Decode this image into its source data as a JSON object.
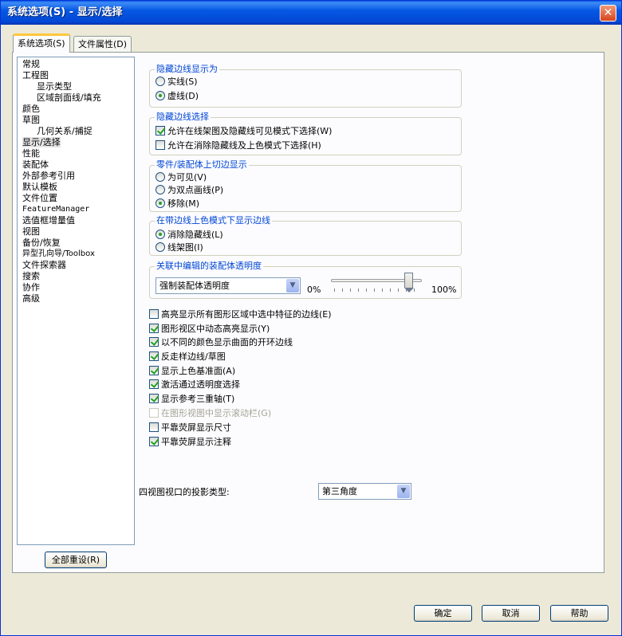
{
  "window": {
    "title": "系统选项(S) - 显示/选择"
  },
  "tabs": [
    "系统选项(S)",
    "文件属性(D)"
  ],
  "tree": {
    "items": [
      {
        "label": "常规",
        "level": 1,
        "selected": false
      },
      {
        "label": "工程图",
        "level": 1,
        "selected": false
      },
      {
        "label": "显示类型",
        "level": 2,
        "selected": false
      },
      {
        "label": "区域剖面线/填充",
        "level": 2,
        "selected": false
      },
      {
        "label": "颜色",
        "level": 1,
        "selected": false
      },
      {
        "label": "草图",
        "level": 1,
        "selected": false
      },
      {
        "label": "几何关系/捕捉",
        "level": 2,
        "selected": false
      },
      {
        "label": "显示/选择",
        "level": 1,
        "selected": true
      },
      {
        "label": "性能",
        "level": 1,
        "selected": false
      },
      {
        "label": "装配体",
        "level": 1,
        "selected": false
      },
      {
        "label": "外部参考引用",
        "level": 1,
        "selected": false
      },
      {
        "label": "默认模板",
        "level": 1,
        "selected": false
      },
      {
        "label": "文件位置",
        "level": 1,
        "selected": false
      },
      {
        "label": "FeatureManager",
        "level": 1,
        "selected": false
      },
      {
        "label": "选值框增量值",
        "level": 1,
        "selected": false
      },
      {
        "label": "视图",
        "level": 1,
        "selected": false
      },
      {
        "label": "备份/恢复",
        "level": 1,
        "selected": false
      },
      {
        "label": "异型孔向导/Toolbox",
        "level": 1,
        "selected": false
      },
      {
        "label": "文件探索器",
        "level": 1,
        "selected": false
      },
      {
        "label": "搜索",
        "level": 1,
        "selected": false
      },
      {
        "label": "协作",
        "level": 1,
        "selected": false
      },
      {
        "label": "高级",
        "level": 1,
        "selected": false
      }
    ],
    "reset_button": "全部重设(R)"
  },
  "groups": {
    "hidden_edges_display": {
      "title": "隐藏边线显示为",
      "options": [
        {
          "label": "实线(S)",
          "checked": false
        },
        {
          "label": "虚线(D)",
          "checked": true
        }
      ]
    },
    "hidden_edges_selection": {
      "title": "隐藏边线选择",
      "options": [
        {
          "label": "允许在线架图及隐藏线可见模式下选择(W)",
          "checked": true
        },
        {
          "label": "允许在消除隐藏线及上色模式下选择(H)",
          "checked": false
        }
      ]
    },
    "tangent_edges": {
      "title": "零件/装配体上切边显示",
      "options": [
        {
          "label": "为可见(V)",
          "checked": false
        },
        {
          "label": "为双点画线(P)",
          "checked": false
        },
        {
          "label": "移除(M)",
          "checked": true
        }
      ]
    },
    "shaded_edges": {
      "title": "在带边线上色模式下显示边线",
      "options": [
        {
          "label": "消除隐藏线(L)",
          "checked": true
        },
        {
          "label": "线架图(I)",
          "checked": false
        }
      ]
    },
    "transparency": {
      "title": "关联中编辑的装配体透明度",
      "select_value": "强制装配体透明度",
      "min_label": "0%",
      "max_label": "100%",
      "value_percent": 90
    }
  },
  "checkboxes": [
    {
      "label": "高亮显示所有图形区域中选中特征的边线(E)",
      "checked": false,
      "disabled": false
    },
    {
      "label": "图形视区中动态高亮显示(Y)",
      "checked": true,
      "disabled": false
    },
    {
      "label": "以不同的颜色显示曲面的开环边线",
      "checked": true,
      "disabled": false
    },
    {
      "label": "反走样边线/草图",
      "checked": true,
      "disabled": false
    },
    {
      "label": "显示上色基准面(A)",
      "checked": true,
      "disabled": false
    },
    {
      "label": "激活通过透明度选择",
      "checked": true,
      "disabled": false
    },
    {
      "label": "显示参考三重轴(T)",
      "checked": true,
      "disabled": false
    },
    {
      "label": "在图形视图中显示滚动栏(G)",
      "checked": false,
      "disabled": true
    },
    {
      "label": "平靠荧屏显示尺寸",
      "checked": false,
      "disabled": false
    },
    {
      "label": "平靠荧屏显示注释",
      "checked": true,
      "disabled": false
    }
  ],
  "projection": {
    "label": "四视图视口的投影类型:",
    "value": "第三角度"
  },
  "buttons": {
    "ok": "确定",
    "cancel": "取消",
    "help": "帮助"
  }
}
